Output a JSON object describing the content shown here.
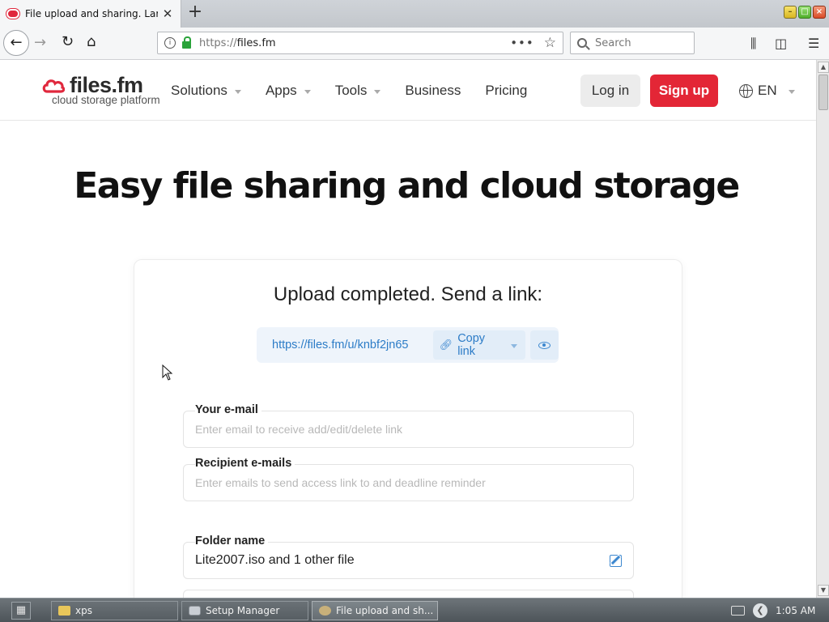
{
  "browser": {
    "tab_title": "File upload and sharing. Large",
    "url_scheme": "https://",
    "url_host": "files.fm",
    "search_placeholder": "Search"
  },
  "site": {
    "logo_text": "files.fm",
    "logo_tagline": "cloud storage platform",
    "nav": [
      {
        "label": "Solutions",
        "has_dropdown": true
      },
      {
        "label": "Apps",
        "has_dropdown": true
      },
      {
        "label": "Tools",
        "has_dropdown": true
      },
      {
        "label": "Business",
        "has_dropdown": false
      },
      {
        "label": "Pricing",
        "has_dropdown": false
      }
    ],
    "login_label": "Log in",
    "signup_label": "Sign up",
    "language": "EN",
    "accent_color": "#e32636",
    "link_color": "#2c7cc7"
  },
  "hero": {
    "title": "Easy file sharing and cloud storage"
  },
  "upload": {
    "heading": "Upload completed. Send a link:",
    "share_url": "https://files.fm/u/knbf2jn65",
    "copy_label": "Copy link",
    "email_label": "Your e-mail",
    "email_placeholder": "Enter email to receive add/edit/delete link",
    "recipients_label": "Recipient e-mails",
    "recipients_placeholder": "Enter emails to send access link to and deadline reminder",
    "folder_label": "Folder name",
    "folder_value": "Lite2007.iso and 1 other file"
  },
  "taskbar": {
    "tasks": [
      {
        "label": "xps",
        "icon": "folder-icon"
      },
      {
        "label": "Setup Manager",
        "icon": "setup-icon"
      },
      {
        "label": "File upload and sh...",
        "icon": "firefox-icon",
        "active": true
      }
    ],
    "clock": "1:05 AM"
  }
}
